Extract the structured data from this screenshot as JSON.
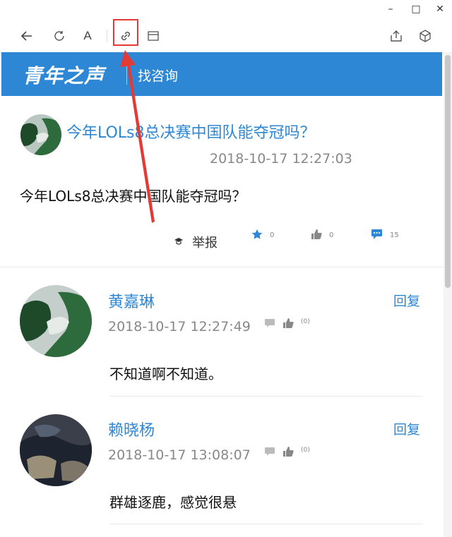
{
  "window_controls": {
    "minimize": "–",
    "maximize": "□",
    "close": "✕"
  },
  "toolbar": {
    "icons": [
      "back-arrow-icon",
      "refresh-icon",
      "font-icon",
      "link-icon",
      "window-icon",
      "share-icon",
      "cube-icon"
    ],
    "font_label": "A"
  },
  "banner": {
    "logo": "青年之声",
    "link": "找咨询",
    "color": "#2d87d4"
  },
  "post": {
    "title": "今年LOLs8总决赛中国队能夺冠吗？",
    "time": "2018-10-17 12:27:03",
    "body": "今年LOLs8总决赛中国队能夺冠吗？",
    "report": "举报",
    "stats": {
      "favorites": "0",
      "likes": "0",
      "comments": "15"
    }
  },
  "comments": [
    {
      "name": "黄嘉琳",
      "time": "2018-10-17 12:27:49",
      "likes": "(0)",
      "reply": "回复",
      "body": "不知道啊不知道。"
    },
    {
      "name": "赖晓杨",
      "time": "2018-10-17 13:08:07",
      "likes": "(0)",
      "reply": "回复",
      "body": "群雄逐鹿，感觉很悬"
    }
  ],
  "colors": {
    "accent": "#2d87d4",
    "highlight": "#e43a36"
  }
}
